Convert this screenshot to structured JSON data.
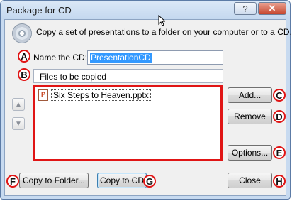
{
  "window": {
    "title": "Package for CD",
    "help_glyph": "?",
    "close_glyph": "✕"
  },
  "description": "Copy a set of presentations to a folder on your computer or to a CD.",
  "name_field": {
    "label": "Name the CD:",
    "value": "PresentationCD"
  },
  "files": {
    "header": "Files to be copied",
    "items": [
      "Six Steps to Heaven.pptx"
    ]
  },
  "buttons": {
    "add": "Add...",
    "remove": "Remove",
    "options": "Options...",
    "copy_to_folder": "Copy to Folder...",
    "copy_to_cd": "Copy to CD",
    "close": "Close",
    "move_up_glyph": "▲",
    "move_down_glyph": "▼"
  },
  "annotations": {
    "a": "A",
    "b": "B",
    "c": "C",
    "d": "D",
    "e": "E",
    "f": "F",
    "g": "G",
    "h": "H"
  },
  "colors": {
    "annotation_red": "#e01515",
    "selection_blue": "#3399ff"
  },
  "icons": {
    "cd": "cd-icon",
    "file": "powerpoint-file-icon"
  }
}
